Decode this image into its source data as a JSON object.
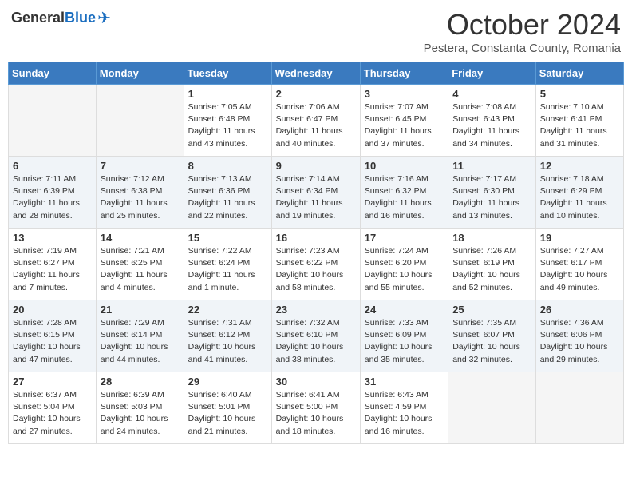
{
  "header": {
    "logo_general": "General",
    "logo_blue": "Blue",
    "month_title": "October 2024",
    "subtitle": "Pestera, Constanta County, Romania"
  },
  "weekdays": [
    "Sunday",
    "Monday",
    "Tuesday",
    "Wednesday",
    "Thursday",
    "Friday",
    "Saturday"
  ],
  "weeks": [
    [
      {
        "day": "",
        "empty": true
      },
      {
        "day": "",
        "empty": true
      },
      {
        "day": "1",
        "sunrise": "Sunrise: 7:05 AM",
        "sunset": "Sunset: 6:48 PM",
        "daylight": "Daylight: 11 hours and 43 minutes."
      },
      {
        "day": "2",
        "sunrise": "Sunrise: 7:06 AM",
        "sunset": "Sunset: 6:47 PM",
        "daylight": "Daylight: 11 hours and 40 minutes."
      },
      {
        "day": "3",
        "sunrise": "Sunrise: 7:07 AM",
        "sunset": "Sunset: 6:45 PM",
        "daylight": "Daylight: 11 hours and 37 minutes."
      },
      {
        "day": "4",
        "sunrise": "Sunrise: 7:08 AM",
        "sunset": "Sunset: 6:43 PM",
        "daylight": "Daylight: 11 hours and 34 minutes."
      },
      {
        "day": "5",
        "sunrise": "Sunrise: 7:10 AM",
        "sunset": "Sunset: 6:41 PM",
        "daylight": "Daylight: 11 hours and 31 minutes."
      }
    ],
    [
      {
        "day": "6",
        "sunrise": "Sunrise: 7:11 AM",
        "sunset": "Sunset: 6:39 PM",
        "daylight": "Daylight: 11 hours and 28 minutes."
      },
      {
        "day": "7",
        "sunrise": "Sunrise: 7:12 AM",
        "sunset": "Sunset: 6:38 PM",
        "daylight": "Daylight: 11 hours and 25 minutes."
      },
      {
        "day": "8",
        "sunrise": "Sunrise: 7:13 AM",
        "sunset": "Sunset: 6:36 PM",
        "daylight": "Daylight: 11 hours and 22 minutes."
      },
      {
        "day": "9",
        "sunrise": "Sunrise: 7:14 AM",
        "sunset": "Sunset: 6:34 PM",
        "daylight": "Daylight: 11 hours and 19 minutes."
      },
      {
        "day": "10",
        "sunrise": "Sunrise: 7:16 AM",
        "sunset": "Sunset: 6:32 PM",
        "daylight": "Daylight: 11 hours and 16 minutes."
      },
      {
        "day": "11",
        "sunrise": "Sunrise: 7:17 AM",
        "sunset": "Sunset: 6:30 PM",
        "daylight": "Daylight: 11 hours and 13 minutes."
      },
      {
        "day": "12",
        "sunrise": "Sunrise: 7:18 AM",
        "sunset": "Sunset: 6:29 PM",
        "daylight": "Daylight: 11 hours and 10 minutes."
      }
    ],
    [
      {
        "day": "13",
        "sunrise": "Sunrise: 7:19 AM",
        "sunset": "Sunset: 6:27 PM",
        "daylight": "Daylight: 11 hours and 7 minutes."
      },
      {
        "day": "14",
        "sunrise": "Sunrise: 7:21 AM",
        "sunset": "Sunset: 6:25 PM",
        "daylight": "Daylight: 11 hours and 4 minutes."
      },
      {
        "day": "15",
        "sunrise": "Sunrise: 7:22 AM",
        "sunset": "Sunset: 6:24 PM",
        "daylight": "Daylight: 11 hours and 1 minute."
      },
      {
        "day": "16",
        "sunrise": "Sunrise: 7:23 AM",
        "sunset": "Sunset: 6:22 PM",
        "daylight": "Daylight: 10 hours and 58 minutes."
      },
      {
        "day": "17",
        "sunrise": "Sunrise: 7:24 AM",
        "sunset": "Sunset: 6:20 PM",
        "daylight": "Daylight: 10 hours and 55 minutes."
      },
      {
        "day": "18",
        "sunrise": "Sunrise: 7:26 AM",
        "sunset": "Sunset: 6:19 PM",
        "daylight": "Daylight: 10 hours and 52 minutes."
      },
      {
        "day": "19",
        "sunrise": "Sunrise: 7:27 AM",
        "sunset": "Sunset: 6:17 PM",
        "daylight": "Daylight: 10 hours and 49 minutes."
      }
    ],
    [
      {
        "day": "20",
        "sunrise": "Sunrise: 7:28 AM",
        "sunset": "Sunset: 6:15 PM",
        "daylight": "Daylight: 10 hours and 47 minutes."
      },
      {
        "day": "21",
        "sunrise": "Sunrise: 7:29 AM",
        "sunset": "Sunset: 6:14 PM",
        "daylight": "Daylight: 10 hours and 44 minutes."
      },
      {
        "day": "22",
        "sunrise": "Sunrise: 7:31 AM",
        "sunset": "Sunset: 6:12 PM",
        "daylight": "Daylight: 10 hours and 41 minutes."
      },
      {
        "day": "23",
        "sunrise": "Sunrise: 7:32 AM",
        "sunset": "Sunset: 6:10 PM",
        "daylight": "Daylight: 10 hours and 38 minutes."
      },
      {
        "day": "24",
        "sunrise": "Sunrise: 7:33 AM",
        "sunset": "Sunset: 6:09 PM",
        "daylight": "Daylight: 10 hours and 35 minutes."
      },
      {
        "day": "25",
        "sunrise": "Sunrise: 7:35 AM",
        "sunset": "Sunset: 6:07 PM",
        "daylight": "Daylight: 10 hours and 32 minutes."
      },
      {
        "day": "26",
        "sunrise": "Sunrise: 7:36 AM",
        "sunset": "Sunset: 6:06 PM",
        "daylight": "Daylight: 10 hours and 29 minutes."
      }
    ],
    [
      {
        "day": "27",
        "sunrise": "Sunrise: 6:37 AM",
        "sunset": "Sunset: 5:04 PM",
        "daylight": "Daylight: 10 hours and 27 minutes."
      },
      {
        "day": "28",
        "sunrise": "Sunrise: 6:39 AM",
        "sunset": "Sunset: 5:03 PM",
        "daylight": "Daylight: 10 hours and 24 minutes."
      },
      {
        "day": "29",
        "sunrise": "Sunrise: 6:40 AM",
        "sunset": "Sunset: 5:01 PM",
        "daylight": "Daylight: 10 hours and 21 minutes."
      },
      {
        "day": "30",
        "sunrise": "Sunrise: 6:41 AM",
        "sunset": "Sunset: 5:00 PM",
        "daylight": "Daylight: 10 hours and 18 minutes."
      },
      {
        "day": "31",
        "sunrise": "Sunrise: 6:43 AM",
        "sunset": "Sunset: 4:59 PM",
        "daylight": "Daylight: 10 hours and 16 minutes."
      },
      {
        "day": "",
        "empty": true
      },
      {
        "day": "",
        "empty": true
      }
    ]
  ]
}
